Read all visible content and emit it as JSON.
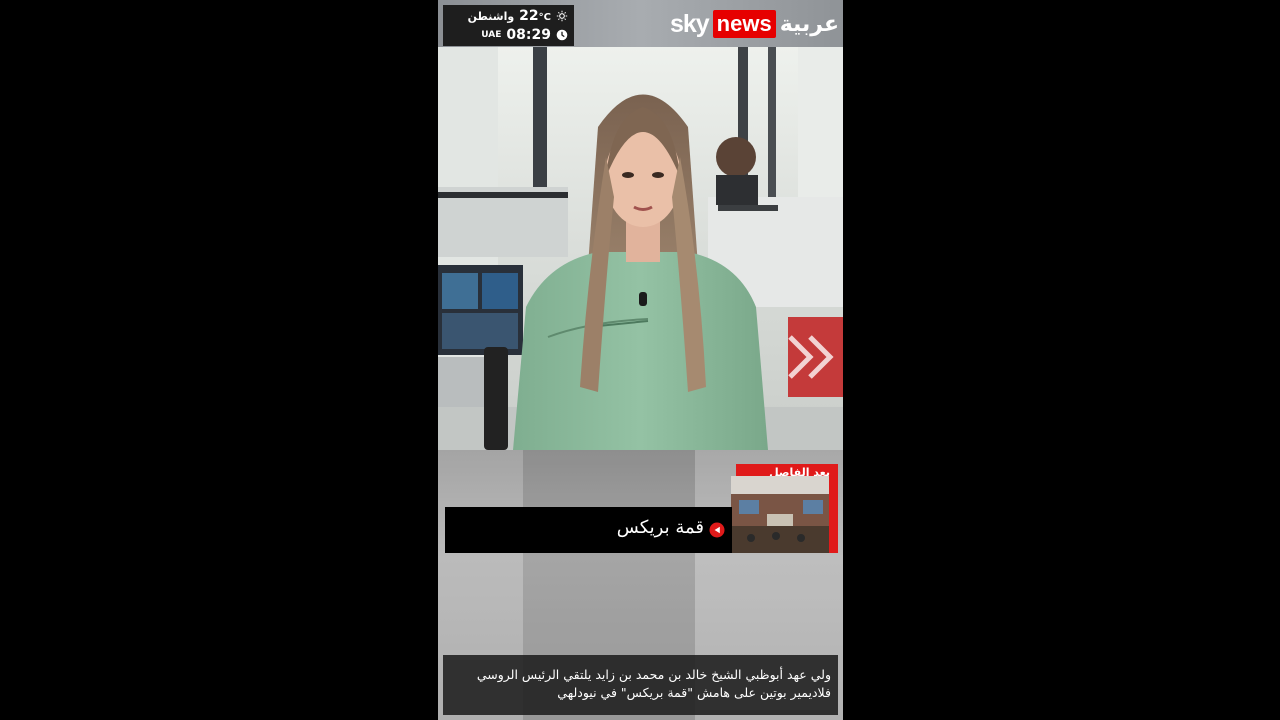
{
  "channel": {
    "logo_sky": "sky",
    "logo_news": "news",
    "logo_arabic": "عربية",
    "brand_red": "#e60000"
  },
  "info": {
    "city": "واشنطن",
    "temperature": "22",
    "unit": "°C",
    "time": "08:29",
    "region": "UAE",
    "weather_icon": "weather-icon",
    "clock_icon": "clock-icon"
  },
  "next_up": {
    "label": "بعد الفاصل"
  },
  "topic": {
    "title": "قمة بريكس",
    "icon": "play-icon"
  },
  "ticker": {
    "text": "ولي عهد أبوظبي الشيخ خالد بن محمد بن زايد يلتقي الرئيس الروسي فلاديمير بوتين على هامش \"قمة بريكس\" في نيودلهي"
  }
}
